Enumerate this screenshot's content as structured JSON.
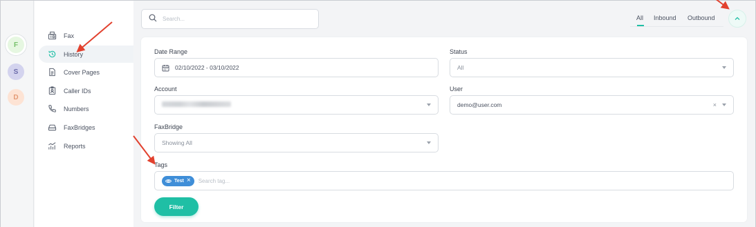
{
  "workspaces": [
    {
      "letter": "F"
    },
    {
      "letter": "S"
    },
    {
      "letter": "D"
    }
  ],
  "nav": {
    "items": [
      {
        "label": "Fax",
        "icon": "fax-icon"
      },
      {
        "label": "History",
        "icon": "history-icon",
        "active": true
      },
      {
        "label": "Cover Pages",
        "icon": "document-icon"
      },
      {
        "label": "Caller IDs",
        "icon": "id-card-icon"
      },
      {
        "label": "Numbers",
        "icon": "phone-icon"
      },
      {
        "label": "FaxBridges",
        "icon": "drive-icon"
      },
      {
        "label": "Reports",
        "icon": "chart-icon"
      }
    ]
  },
  "search": {
    "placeholder": "Search..."
  },
  "tabs": {
    "all": "All",
    "inbound": "Inbound",
    "outbound": "Outbound"
  },
  "filters": {
    "date_range": {
      "label": "Date Range",
      "value": "02/10/2022 - 03/10/2022"
    },
    "status": {
      "label": "Status",
      "value": "All"
    },
    "account": {
      "label": "Account"
    },
    "user": {
      "label": "User",
      "value": "demo@user.com"
    },
    "faxbridge": {
      "label": "FaxBridge",
      "value": "Showing All"
    },
    "tags": {
      "label": "Tags",
      "chip": "Test",
      "placeholder": "Search tag..."
    },
    "filter_button": "Filter"
  },
  "colors": {
    "accent": "#1fbfa5",
    "tag": "#3f8ed8",
    "annotation_arrow": "#e2412e"
  }
}
